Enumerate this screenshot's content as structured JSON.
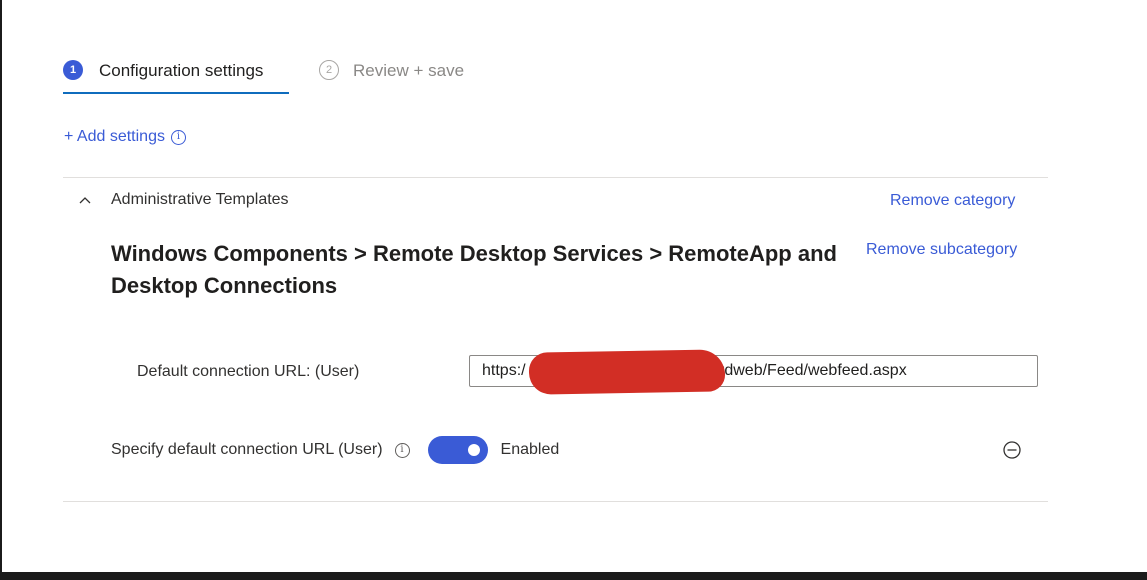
{
  "steps": [
    {
      "number": "1",
      "label": "Configuration settings"
    },
    {
      "number": "2",
      "label": "Review + save"
    }
  ],
  "add_settings": {
    "label": "+ Add settings",
    "info_icon": "ⓘ"
  },
  "category": {
    "name": "Administrative Templates",
    "remove_label": "Remove category"
  },
  "subcategory": {
    "title": "Windows Components > Remote Desktop Services > RemoteApp and Desktop Connections",
    "remove_label": "Remove subcategory"
  },
  "settings": {
    "url_label": "Default connection URL: (User)",
    "url_value_start": "https:/",
    "url_value_end": "/rdweb/Feed/webfeed.aspx",
    "toggle_label": "Specify default connection URL (User)",
    "toggle_state": "Enabled"
  },
  "colors": {
    "accent": "#3a5bd6",
    "redaction": "#d22e25"
  },
  "icons": {
    "info": "info-icon",
    "collapse": "chevron-up-icon",
    "remove": "minus-circle-icon"
  }
}
